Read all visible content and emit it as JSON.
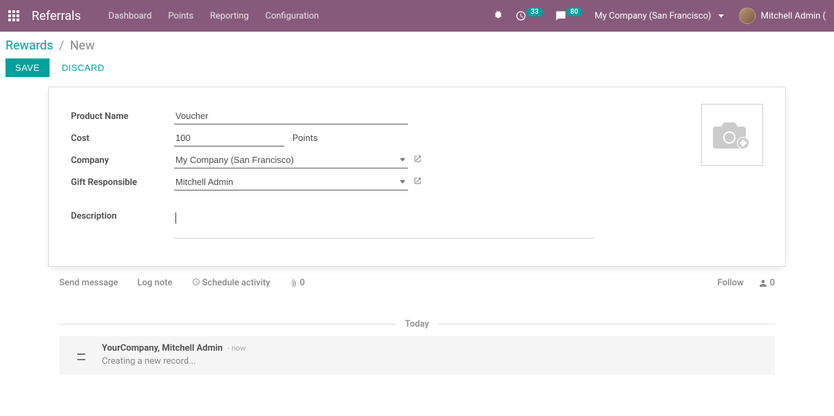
{
  "navbar": {
    "brand": "Referrals",
    "items": [
      "Dashboard",
      "Points",
      "Reporting",
      "Configuration"
    ],
    "clock_badge": "33",
    "chat_badge": "80",
    "company": "My Company (San Francisco)",
    "user": "Mitchell Admin ("
  },
  "breadcrumb": {
    "parent": "Rewards",
    "current": "New"
  },
  "actions": {
    "save": "SAVE",
    "discard": "DISCARD"
  },
  "form": {
    "labels": {
      "product_name": "Product Name",
      "cost": "Cost",
      "points_suffix": "Points",
      "company": "Company",
      "gift_responsible": "Gift Responsible",
      "description": "Description"
    },
    "values": {
      "product_name": "Voucher",
      "cost": "100",
      "company": "My Company (San Francisco)",
      "gift_responsible": "Mitchell Admin",
      "description": ""
    }
  },
  "chatter": {
    "send_message": "Send message",
    "log_note": "Log note",
    "schedule_activity": "Schedule activity",
    "attachments": "0",
    "follow": "Follow",
    "followers_count": "0",
    "day_label": "Today",
    "message": {
      "author": "YourCompany, Mitchell Admin",
      "time": "- now",
      "body": "Creating a new record..."
    }
  }
}
